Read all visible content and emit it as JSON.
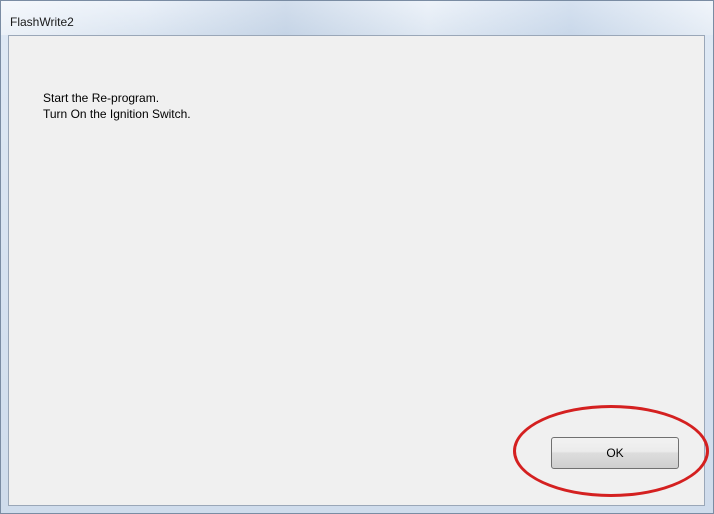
{
  "window": {
    "title": "FlashWrite2"
  },
  "dialog": {
    "lines": [
      "Start the Re-program.",
      "Turn On the Ignition Switch."
    ],
    "ok_label": "OK"
  },
  "annotation": {
    "color": "#d42020"
  }
}
